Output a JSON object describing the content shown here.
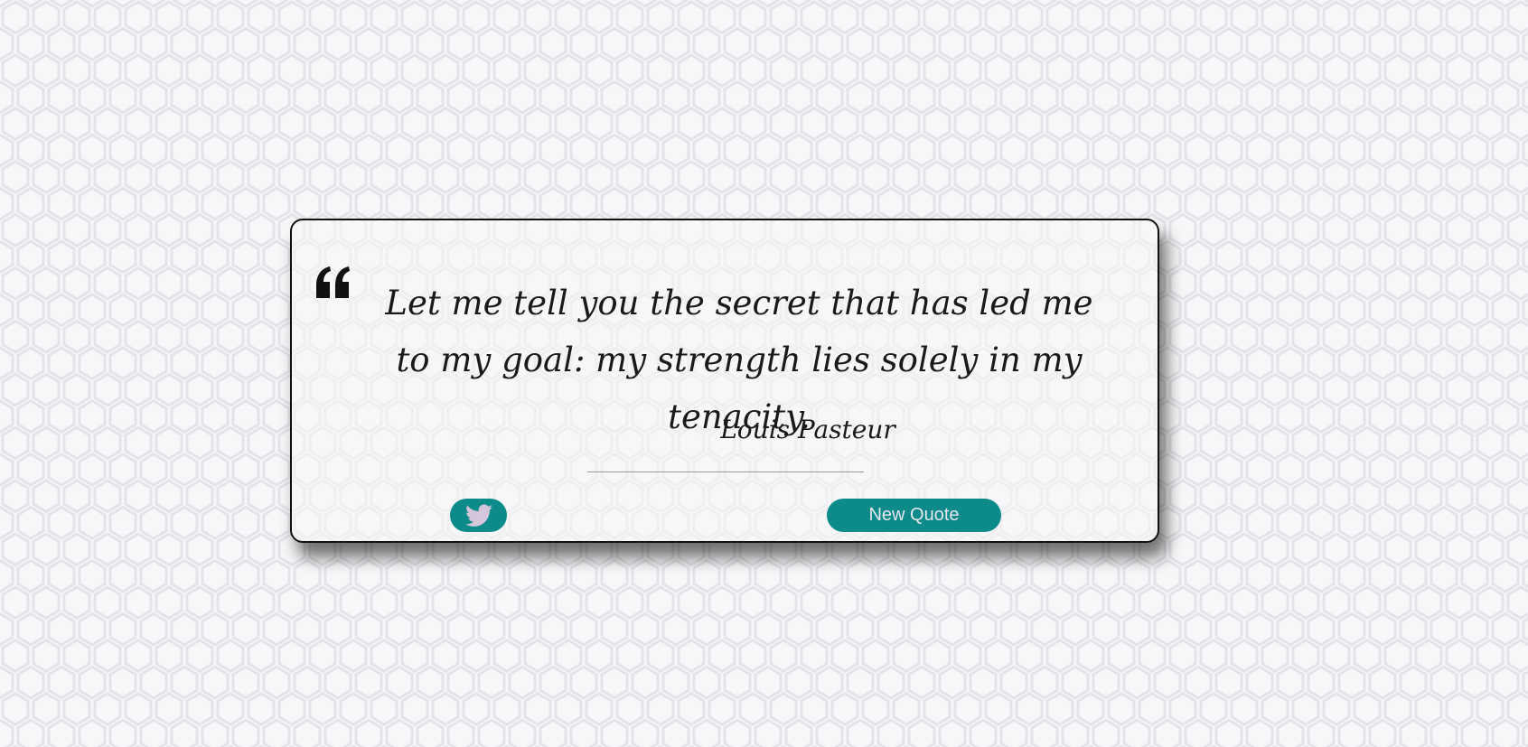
{
  "quote": {
    "text": "Let me tell you the secret that has led me to my goal: my strength lies solely in my tenacity.",
    "author": "Louis Pasteur"
  },
  "actions": {
    "tweet_icon": "twitter-bird-icon",
    "new_quote_label": "New Quote"
  },
  "colors": {
    "accent": "#0d8a8a",
    "background": "#f7f7f9",
    "hex_pattern": "#e4e4e8",
    "icon": "#d6c6dc",
    "button_text": "#e6e6ee"
  }
}
